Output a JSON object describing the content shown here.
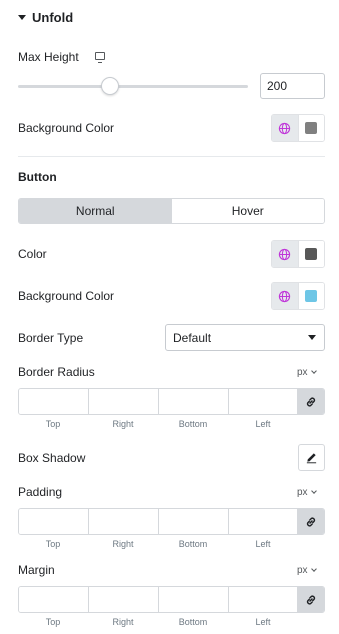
{
  "section": {
    "title": "Unfold"
  },
  "max_height": {
    "label": "Max Height",
    "value": "200",
    "slider_fraction": 0.4
  },
  "background_color": {
    "label": "Background Color",
    "swatch": "#808080"
  },
  "button": {
    "heading": "Button",
    "tabs": [
      {
        "label": "Normal",
        "active": true
      },
      {
        "label": "Hover",
        "active": false
      }
    ],
    "color": {
      "label": "Color",
      "swatch": "#585858"
    },
    "background_color": {
      "label": "Background Color",
      "swatch": "#6ec6e6"
    },
    "border_type": {
      "label": "Border Type",
      "selected": "Default"
    },
    "border_radius": {
      "label": "Border Radius",
      "unit": "px"
    },
    "box_shadow": {
      "label": "Box Shadow"
    },
    "padding": {
      "label": "Padding",
      "unit": "px"
    },
    "margin": {
      "label": "Margin",
      "unit": "px"
    }
  },
  "dimension_labels": {
    "top": "Top",
    "right": "Right",
    "bottom": "Bottom",
    "left": "Left"
  },
  "icons": {
    "globe": "globe-icon",
    "link": "link-icon",
    "edit": "pencil-icon",
    "device": "desktop-icon"
  },
  "colors": {
    "globe_accent": "#c036d9"
  }
}
